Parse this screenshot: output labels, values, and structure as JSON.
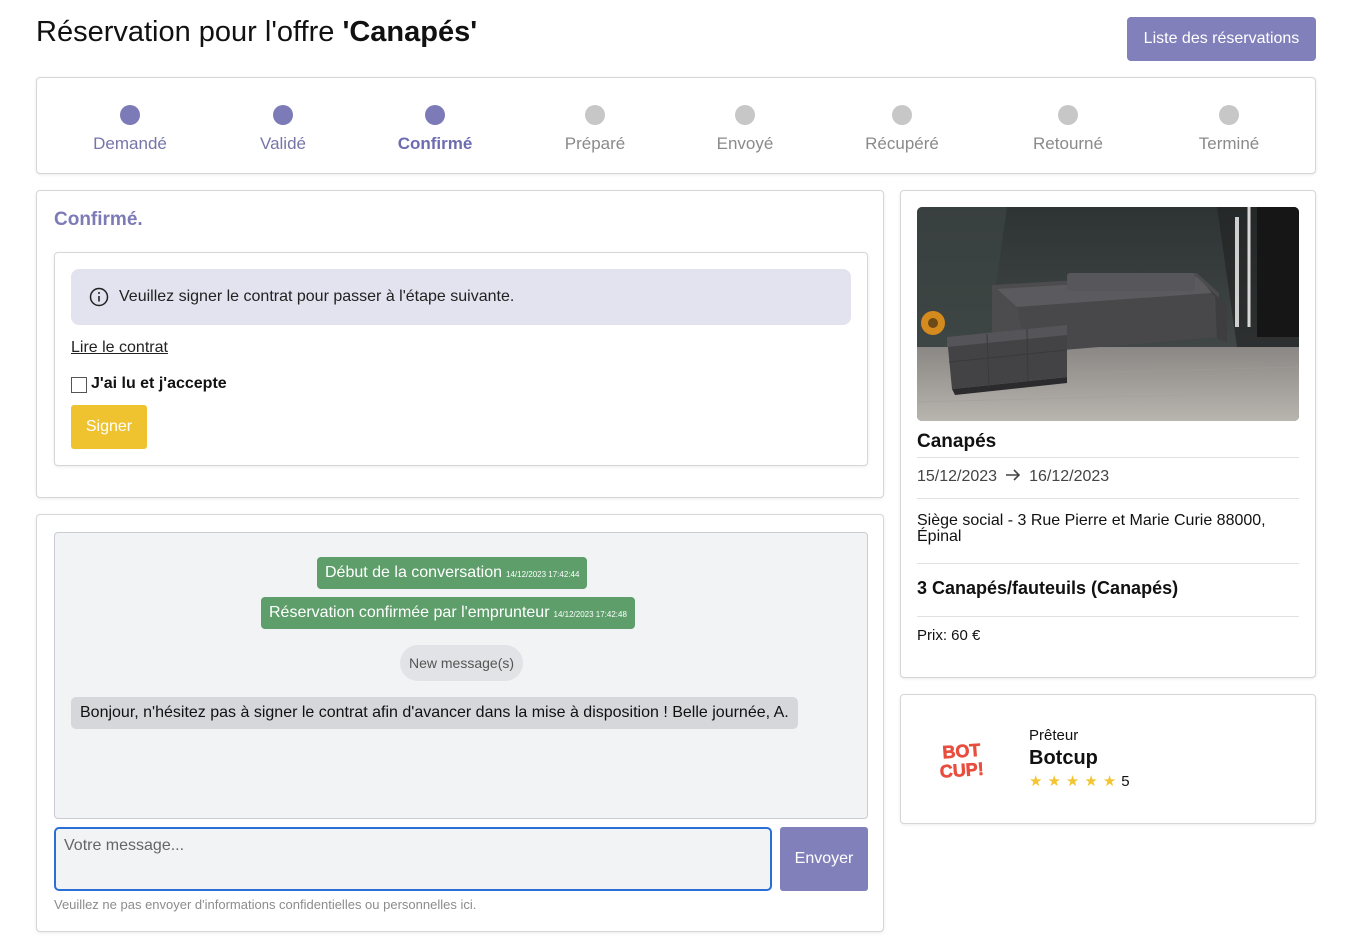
{
  "header": {
    "title_prefix": "Réservation pour l'offre ",
    "title_offer": "'Canapés'",
    "list_button": "Liste des réservations"
  },
  "steps": [
    {
      "label": "Demandé",
      "state": "done"
    },
    {
      "label": "Validé",
      "state": "done"
    },
    {
      "label": "Confirmé",
      "state": "current"
    },
    {
      "label": "Préparé",
      "state": "todo"
    },
    {
      "label": "Envoyé",
      "state": "todo"
    },
    {
      "label": "Récupéré",
      "state": "todo"
    },
    {
      "label": "Retourné",
      "state": "todo"
    },
    {
      "label": "Terminé",
      "state": "todo"
    }
  ],
  "status": {
    "title": "Confirmé.",
    "alert": "Veuillez signer le contrat pour passer à l'étape suivante.",
    "contract_link": "Lire le contrat",
    "accept_label": "J'ai lu et j'accepte",
    "sign_button": "Signer"
  },
  "chat": {
    "messages": [
      {
        "text": "Début de la conversation",
        "time": "14/12/2023 17:42:44"
      },
      {
        "text": "Réservation confirmée par l'emprunteur",
        "time": "14/12/2023 17:42:48"
      }
    ],
    "new_messages": "New message(s)",
    "user_message": "Bonjour, n'hésitez pas à signer le contrat afin d'avancer dans la mise à disposition ! Belle journée, A.",
    "input_placeholder": "Votre message...",
    "send_button": "Envoyer",
    "disclaimer": "Veuillez ne pas envoyer d'informations confidentielles ou personnelles ici."
  },
  "offer": {
    "name": "Canapés",
    "date_start": "15/12/2023",
    "date_end": "16/12/2023",
    "address": "Siège social - 3 Rue Pierre et Marie Curie 88000, Épinal",
    "category": "3 Canapés/fauteuils (Canapés)",
    "price": "Prix: 60 €"
  },
  "lender": {
    "role": "Prêteur",
    "name": "Botcup",
    "rating": "5",
    "logo_text_top": "BOT",
    "logo_text_bottom": "CUP!"
  },
  "colors": {
    "primary": "#8180bb",
    "success": "#5e9e6a",
    "warning": "#efc330",
    "star": "#f2c531"
  }
}
